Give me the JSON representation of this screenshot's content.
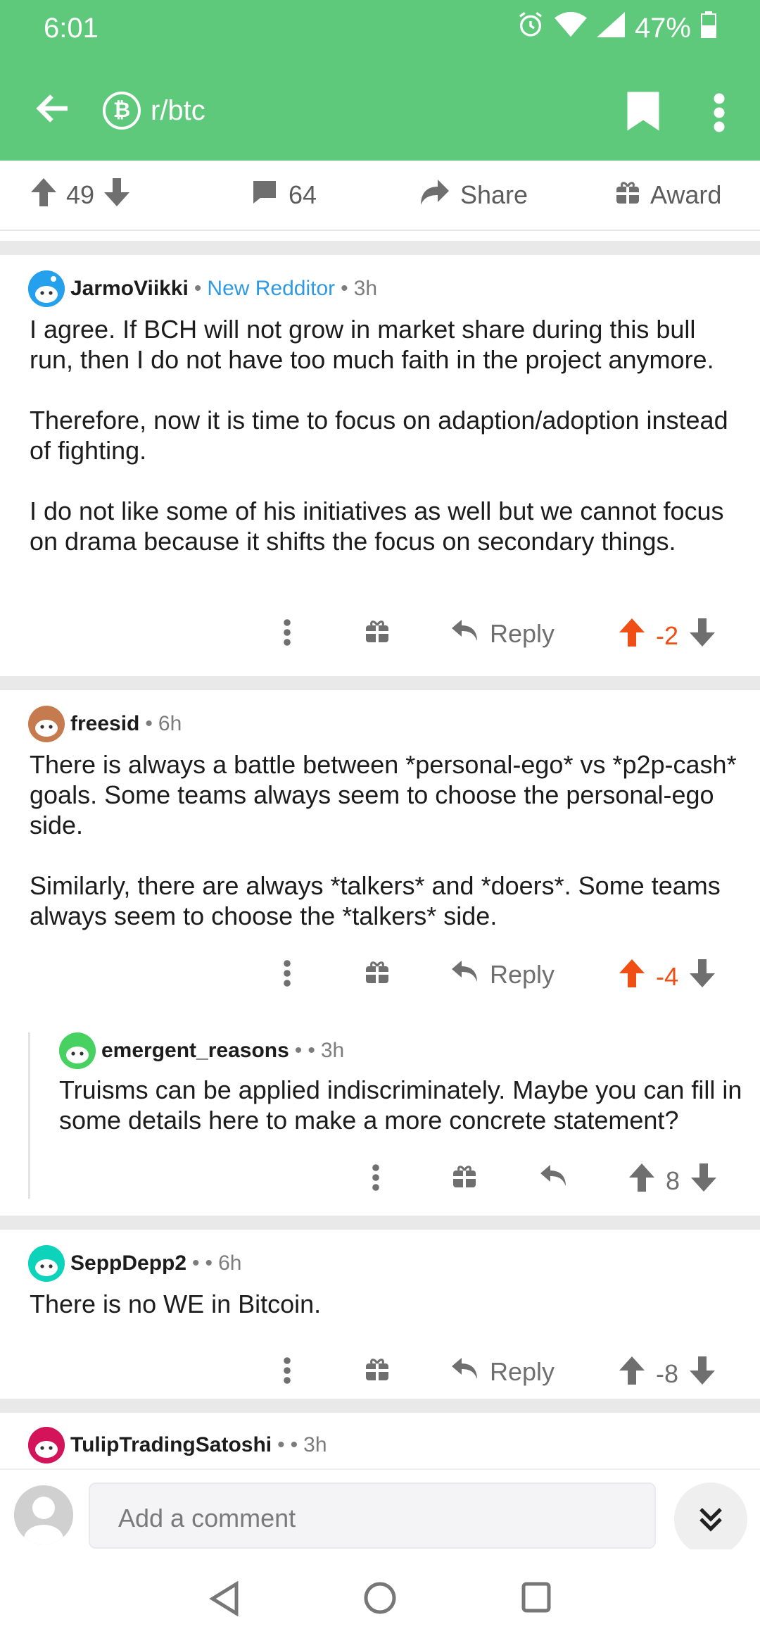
{
  "status": {
    "time": "6:01",
    "battery": "47%"
  },
  "header": {
    "subreddit": "r/btc",
    "coin_symbol": "₿"
  },
  "post_bar": {
    "upvotes": "49",
    "comments": "64",
    "share": "Share",
    "award": "Award"
  },
  "comments": [
    {
      "user": "JarmoViikki",
      "flair": "New Redditor",
      "age": "3h",
      "paragraphs": [
        "I agree. If BCH will not grow in market share during this bull run, then I do not have too much faith in the project anymore.",
        "Therefore, now it is time to focus on adaption/adoption instead of fighting.",
        "I do not like some of his initiatives as well but we cannot focus on drama because it shifts the focus on secondary things."
      ],
      "reply": "Reply",
      "score": "-2",
      "upvoted": true
    },
    {
      "user": "freesid",
      "age": "6h",
      "paragraphs": [
        "There is always a battle between *personal-ego* vs *p2p-cash* goals.  Some teams always seem to choose the personal-ego side.",
        "Similarly, there are always *talkers* and *doers*. Some teams always seem to choose the *talkers* side."
      ],
      "reply": "Reply",
      "score": "-4",
      "upvoted": true
    },
    {
      "user": "emergent_reasons",
      "age": "3h",
      "paragraphs": [
        "Truisms can be applied indiscriminately. Maybe you can fill in some details here to make a more concrete statement?"
      ],
      "score": "8"
    },
    {
      "user": "SeppDepp2",
      "age": "6h",
      "paragraphs": [
        "There is no WE in Bitcoin."
      ],
      "reply": "Reply",
      "score": "-8"
    },
    {
      "user": "TulipTradingSatoshi",
      "age": "3h"
    }
  ],
  "composer": {
    "placeholder": "Add a comment"
  },
  "colors": {
    "brand": "#5ec97a",
    "upvote_active": "#ef4e14",
    "flair": "#2f9ae3"
  }
}
